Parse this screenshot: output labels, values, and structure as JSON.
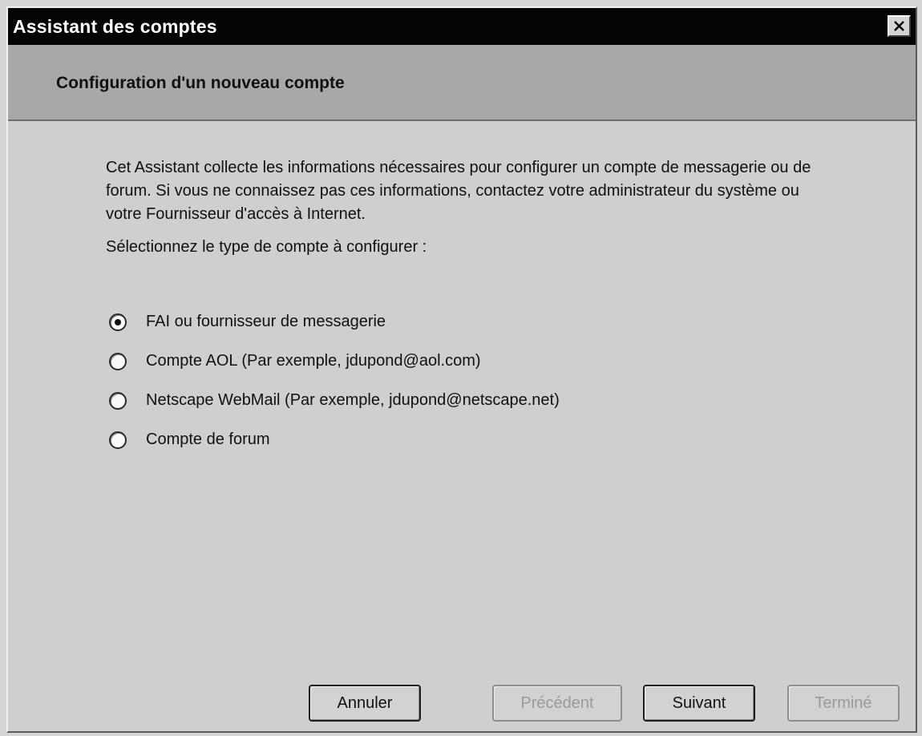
{
  "window": {
    "title": "Assistant des comptes"
  },
  "header": {
    "title": "Configuration d'un nouveau compte"
  },
  "content": {
    "intro": "Cet Assistant collecte les informations nécessaires pour configurer un compte de messagerie ou de forum. Si vous ne connaissez pas ces informations, contactez votre administrateur du système ou votre Fournisseur d'accès à Internet.",
    "prompt": "Sélectionnez le type de compte à configurer :"
  },
  "options": [
    {
      "label": "FAI ou fournisseur de messagerie",
      "selected": true
    },
    {
      "label": "Compte AOL (Par exemple, jdupond@aol.com)",
      "selected": false
    },
    {
      "label": "Netscape WebMail (Par exemple, jdupond@netscape.net)",
      "selected": false
    },
    {
      "label": "Compte de forum",
      "selected": false
    }
  ],
  "buttons": {
    "cancel": "Annuler",
    "previous": "Précédent",
    "next": "Suivant",
    "finish": "Terminé"
  },
  "icons": {
    "close": "close-icon"
  },
  "colors": {
    "titlebar": "#050505",
    "header_band": "#a8a8a8",
    "body": "#cfcfcf"
  }
}
